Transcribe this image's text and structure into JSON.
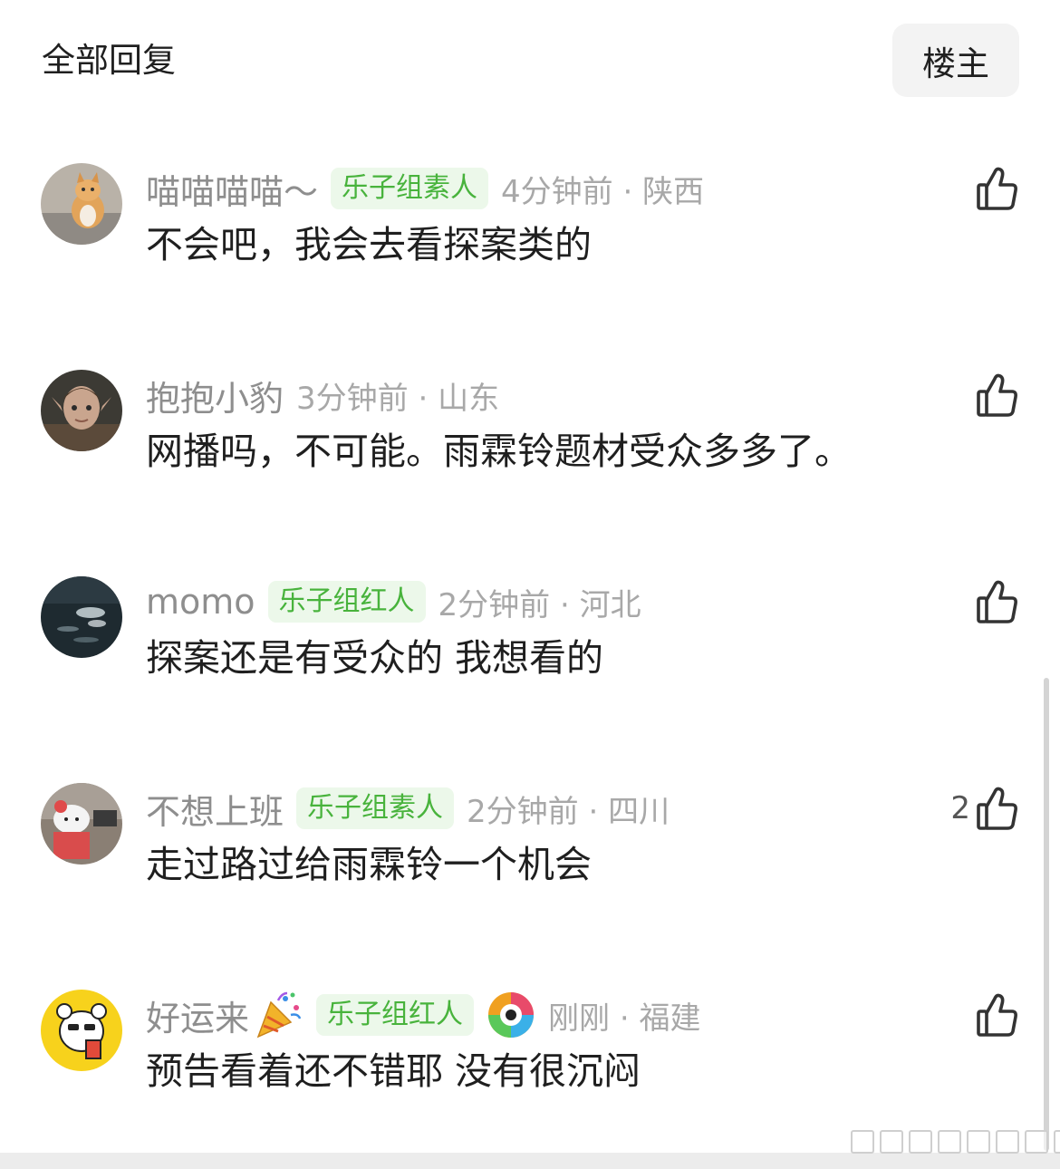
{
  "header": {
    "title": "全部回复",
    "op_button": "楼主"
  },
  "comments": [
    {
      "username": "喵喵喵喵～",
      "badge": "乐子组素人",
      "time_location": "4分钟前 · 陕西",
      "text": "不会吧，我会去看探案类的",
      "likes": ""
    },
    {
      "username": "抱抱小豹",
      "badge": "",
      "time_location": "3分钟前 · 山东",
      "text": "网播吗，不可能。雨霖铃题材受众多多了。",
      "likes": ""
    },
    {
      "username": "momo",
      "badge": "乐子组红人",
      "time_location": "2分钟前 · 河北",
      "text": "探案还是有受众的 我想看的",
      "likes": ""
    },
    {
      "username": "不想上班",
      "badge": "乐子组素人",
      "time_location": "2分钟前 · 四川",
      "text": "走过路过给雨霖铃一个机会",
      "likes": "2"
    },
    {
      "username": "好运来",
      "badge": "乐子组红人",
      "time_location": "刚刚 · 福建",
      "text": "预告看着还不错耶 没有很沉闷",
      "likes": ""
    }
  ],
  "icons": {
    "like": "thumbs-up-icon",
    "party": "party-popper-icon"
  },
  "colors": {
    "badge_bg": "#ecf8ea",
    "badge_text": "#48b33c",
    "meta_text": "#a8a8a8",
    "username_text": "#8e8e8e"
  }
}
